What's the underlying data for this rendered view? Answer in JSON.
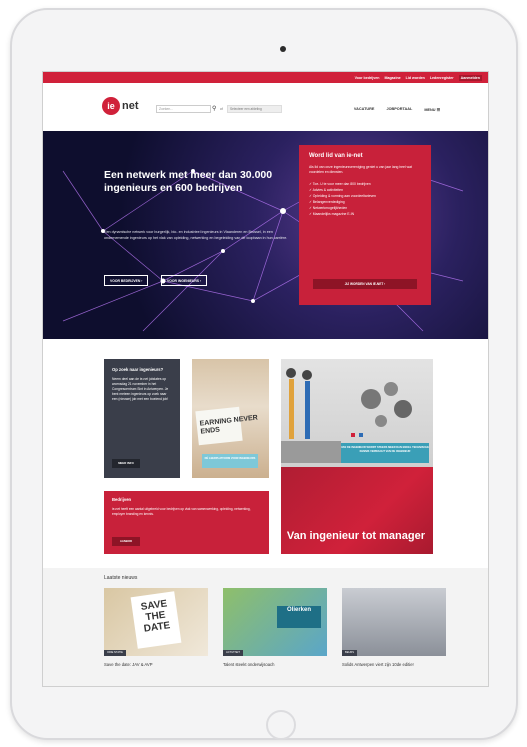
{
  "topbar": {
    "links": [
      "Voor bedrijven",
      "Magazine",
      "Lid worden",
      "Ledenregister"
    ],
    "login": "Aanmelden"
  },
  "header": {
    "logo": "ie",
    "logo_net": "net",
    "search_placeholder": "Zoeken...",
    "of": "of",
    "select_placeholder": "Selecteer een afdeling",
    "nav": [
      "VACATURE",
      "JOBPORTAAL",
      "MENU"
    ]
  },
  "hero": {
    "title": "Een netwerk met meer dan 30.000 ingenieurs en 600 bedrijven",
    "text": "Een dynamische netwerk voor burgerlijk, bio- en industrieel ingenieurs in Vlaanderen en Brussel, in een ondernemende ingenieurs op het vlak van opleiding, netwerking en begeleiding van de loopbaan in hun carrière.",
    "btn_left": "VOOR BEDRIJVEN",
    "btn_right": "VOOR INGENIEURS"
  },
  "join": {
    "title": "Word lid van ie-net",
    "text": "Als lid van onze ingenieursvereniging geniet u van jaar lang heel wat voordelen en diensten.",
    "items": [
      "Toe- U te voor meer dan 800 bedrijven",
      "Advies & activiteiten",
      "Opleiding & vorming aan voordeeltarieven",
      "Belangenverdediging",
      "Netwerkmogelijkheden",
      "Maandelijks magazine E-IN"
    ],
    "button": "JIJ WORDEN VAN IE-NET"
  },
  "cards": {
    "dark_title": "Op zoek naar ingenieurs?",
    "dark_text": "Neem deel aan de ie-net jobdates op woensdag 21 november in het Congrescentrum Sint in Antwerpen. Je bent meteen ingenieurs op zoek naar een (nieuwe) job met een boeiend job!",
    "dark_btn": "MEER INFO",
    "learning_sign": "EARNING NEVER ENDS",
    "learning_caption": "DÉ LEERPLATFORM VOOR INGENIEURS",
    "gears_banner": "VAN DE INGENIEUR WORDT STEEDS MEER DAN ENKEL TECHNISCHE KENNIS VERWACHT VAN DE INGENIEUR",
    "red_title": "Bedrijven",
    "red_text": "ie-net heeft een aantal uitgebreid voor bedrijven op vlak van samenwerking, opleiding, netwerking, employer branding en kennis.",
    "red_btn": "AANBOD",
    "manager_title": "Van ingenieur tot manager"
  },
  "news": {
    "heading": "Laatste nieuws",
    "items": [
      {
        "title": "Save the date: JAV & AVP",
        "tag": "ORIE NTATIE"
      },
      {
        "title": "Talent steekt onderwijsoach",
        "tag": "ACTIVITEIT"
      },
      {
        "title": "Solids Antwerpen viert zijn 10de editie!",
        "tag": "BEURS"
      }
    ]
  },
  "colors": {
    "brand_red": "#d0213a",
    "dark_card": "#3a3e4a"
  }
}
